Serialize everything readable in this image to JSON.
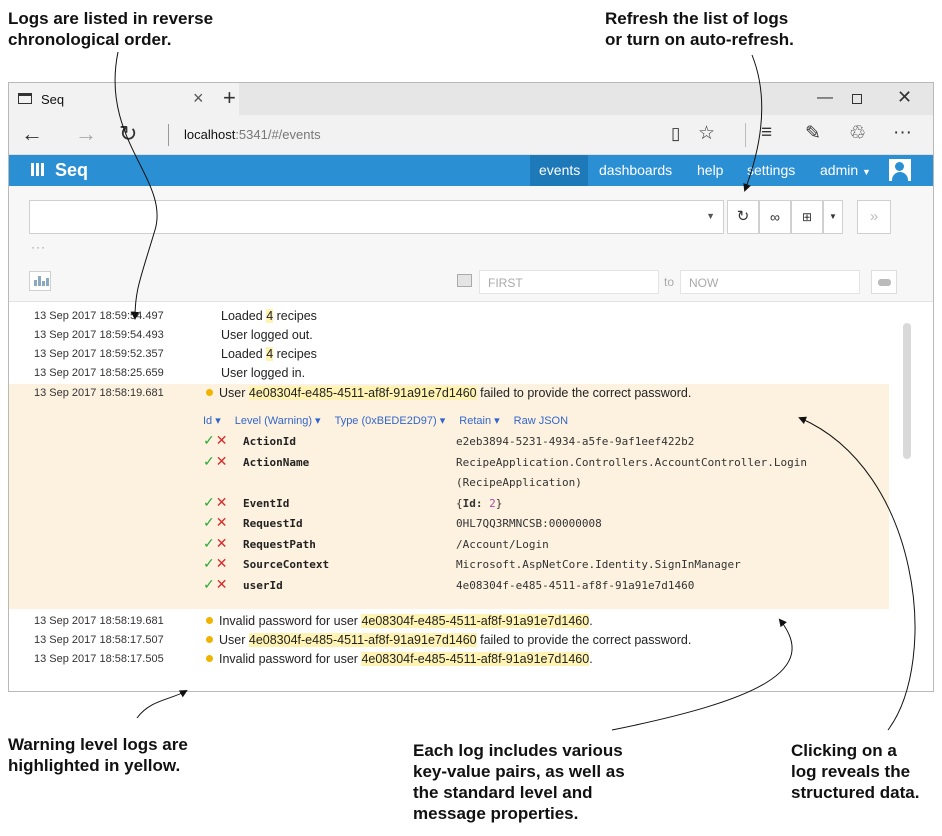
{
  "annotations": {
    "top_left": "Logs are listed in reverse\nchronological order.",
    "top_right": "Refresh the list of logs\nor turn on auto-refresh.",
    "bottom_left": "Warning level logs are\nhighlighted in yellow.",
    "bottom_center": "Each log includes various\nkey-value pairs, as well as\nthe standard level and\nmessage properties.",
    "bottom_right": "Clicking on a\nlog reveals the\nstructured data."
  },
  "browser": {
    "tab_title": "Seq",
    "tab_close": "×",
    "new_tab": "+",
    "url_host": "localhost",
    "url_rest": ":5341/#/events",
    "icons": [
      "back-arrow-icon",
      "forward-arrow-icon",
      "refresh-icon",
      "reading-view-icon",
      "favorite-star-icon",
      "hub-icon",
      "web-note-icon",
      "share-icon",
      "more-icon"
    ]
  },
  "app": {
    "logo": "Seq",
    "nav": {
      "events": "events",
      "dashboards": "dashboards",
      "help": "help",
      "settings": "settings",
      "admin": "admin"
    },
    "accent": "#2b8fd4"
  },
  "filter": {
    "dots": "···",
    "range_from": "FIRST",
    "range_to_label": "to",
    "range_to": "NOW"
  },
  "events_top": [
    {
      "date": "13 Sep 2017",
      "time": "18:59:54.497",
      "msg_pre": "Loaded ",
      "msg_hl": "4",
      "msg_post": " recipes"
    },
    {
      "date": "13 Sep 2017",
      "time": "18:59:54.493",
      "msg_pre": "User logged out.",
      "msg_hl": "",
      "msg_post": ""
    },
    {
      "date": "13 Sep 2017",
      "time": "18:59:52.357",
      "msg_pre": "Loaded ",
      "msg_hl": "4",
      "msg_post": " recipes"
    },
    {
      "date": "13 Sep 2017",
      "time": "18:58:25.659",
      "msg_pre": "User logged in.",
      "msg_hl": "",
      "msg_post": ""
    }
  ],
  "expanded": {
    "date": "13 Sep 2017",
    "time": "18:58:19.681",
    "msg_pre": "User ",
    "msg_hl": "4e08304f-e485-4511-af8f-91a91e7d1460",
    "msg_post": " failed to provide the correct password.",
    "actions": [
      "Id ▾",
      "Level (Warning) ▾",
      "Type (0xBEDE2D97) ▾",
      "Retain ▾",
      "Raw JSON"
    ],
    "properties": [
      {
        "name": "ActionId",
        "value": "e2eb3894-5231-4934-a5fe-9af1eef422b2"
      },
      {
        "name": "ActionName",
        "value": "RecipeApplication.Controllers.AccountController.Login"
      },
      {
        "name": "",
        "value": "(RecipeApplication)"
      },
      {
        "name": "EventId",
        "value": "{Id: 2}"
      },
      {
        "name": "RequestId",
        "value": "0HL7QQ3RMNCSB:00000008"
      },
      {
        "name": "RequestPath",
        "value": "/Account/Login"
      },
      {
        "name": "SourceContext",
        "value": "Microsoft.AspNetCore.Identity.SignInManager"
      },
      {
        "name": "userId",
        "value": "4e08304f-e485-4511-af8f-91a91e7d1460"
      }
    ]
  },
  "events_bottom": [
    {
      "date": "13 Sep 2017",
      "time": "18:58:19.681",
      "msg_pre": "Invalid password for user ",
      "msg_hl": "4e08304f-e485-4511-af8f-91a91e7d1460",
      "msg_post": "."
    },
    {
      "date": "13 Sep 2017",
      "time": "18:58:17.507",
      "msg_pre": "User ",
      "msg_hl": "4e08304f-e485-4511-af8f-91a91e7d1460",
      "msg_post": " failed to provide the correct password."
    },
    {
      "date": "13 Sep 2017",
      "time": "18:58:17.505",
      "msg_pre": "Invalid password for user ",
      "msg_hl": "4e08304f-e485-4511-af8f-91a91e7d1460",
      "msg_post": "."
    }
  ],
  "colors": {
    "warning_dot": "#f0b400",
    "warning_bg": "#fdf2e0",
    "value_highlight": "#fff3b3"
  }
}
